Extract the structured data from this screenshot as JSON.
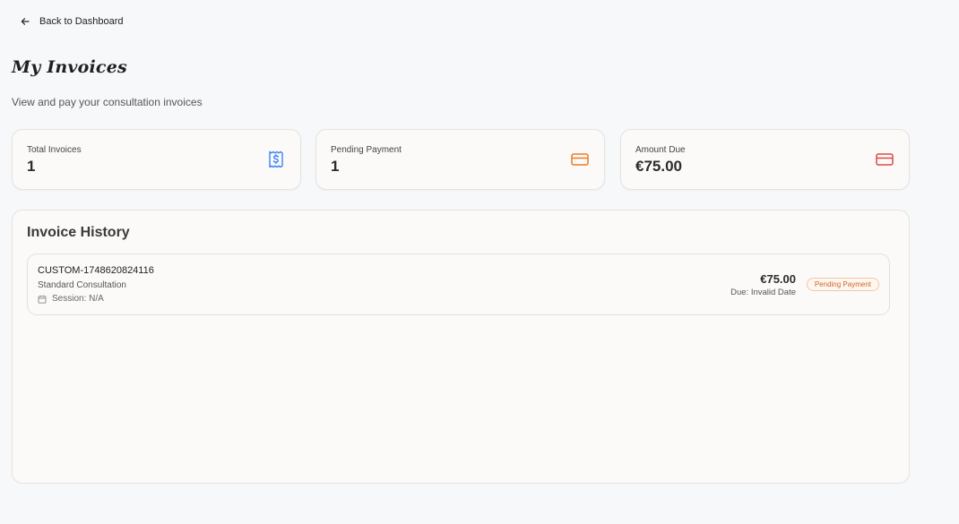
{
  "nav": {
    "back_label": "Back to Dashboard"
  },
  "header": {
    "title": "My Invoices",
    "subtitle": "View and pay your consultation invoices"
  },
  "stats": [
    {
      "label": "Total Invoices",
      "value": "1",
      "icon": "receipt-dollar-icon",
      "color": "#3b82f6"
    },
    {
      "label": "Pending Payment",
      "value": "1",
      "icon": "credit-card-icon",
      "color": "#f07a24"
    },
    {
      "label": "Amount Due",
      "value": "€75.00",
      "icon": "credit-card-icon",
      "color": "#e04848"
    }
  ],
  "history": {
    "title": "Invoice History",
    "invoices": [
      {
        "id": "CUSTOM-1748620824116",
        "type": "Standard Consultation",
        "session": "Session: N/A",
        "amount": "€75.00",
        "due": "Due: Invalid Date",
        "status": "Pending Payment",
        "status_color": "#d0632a"
      }
    ]
  }
}
